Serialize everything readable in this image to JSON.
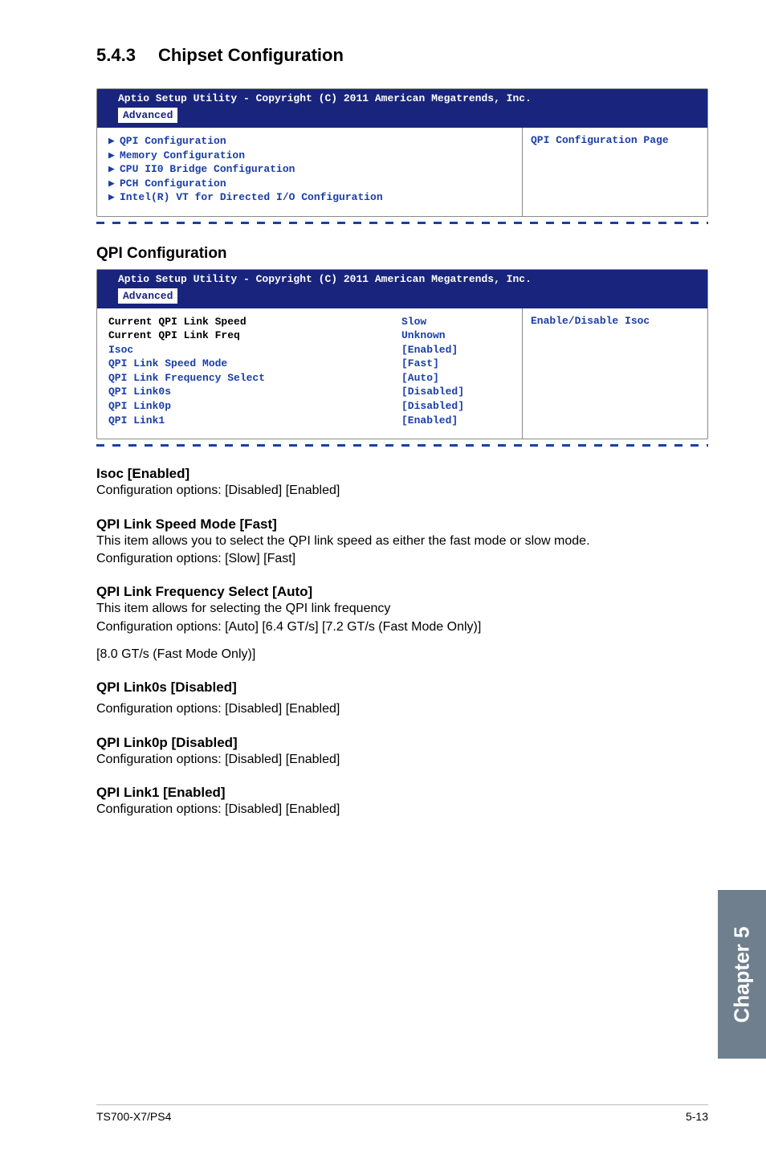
{
  "section": {
    "number": "5.4.3",
    "title": "Chipset Configuration"
  },
  "bios1": {
    "header": "Aptio Setup Utility - Copyright (C) 2011 American Megatrends, Inc.",
    "tab": "Advanced",
    "menu": [
      "QPI Configuration",
      "Memory Configuration",
      "CPU II0 Bridge Configuration",
      "PCH Configuration",
      "Intel(R) VT for Directed I/O Configuration"
    ],
    "help": "QPI Configuration Page"
  },
  "sub1": {
    "title": "QPI Configuration"
  },
  "bios2": {
    "header": "Aptio Setup Utility - Copyright (C) 2011 American Megatrends, Inc.",
    "tab": "Advanced",
    "rows": [
      {
        "label": "Current QPI Link Speed",
        "value": "Slow",
        "black": true
      },
      {
        "label": "Current QPI Link Freq",
        "value": "Unknown",
        "black": true
      },
      {
        "label": "Isoc",
        "value": "[Enabled]",
        "black": false
      },
      {
        "label": "QPI Link Speed Mode",
        "value": "[Fast]",
        "black": false
      },
      {
        "label": "QPI Link Frequency Select",
        "value": "[Auto]",
        "black": false
      },
      {
        "label": "QPI Link0s",
        "value": "[Disabled]",
        "black": false
      },
      {
        "label": "QPI Link0p",
        "value": "[Disabled]",
        "black": false
      },
      {
        "label": "QPI Link1",
        "value": "[Enabled]",
        "black": false
      }
    ],
    "help": "Enable/Disable Isoc"
  },
  "items": {
    "isoc": {
      "head": "Isoc [Enabled]",
      "body": "Configuration options: [Disabled] [Enabled]"
    },
    "speed": {
      "head": "QPI Link Speed Mode [Fast]",
      "body1": "This item allows you to select the QPI link speed as either the fast mode or slow mode.",
      "body2": "Configuration options: [Slow] [Fast]"
    },
    "freq": {
      "head": "QPI Link Frequency Select [Auto]",
      "body1": "This item allows for selecting the QPI link frequency",
      "body2": "Configuration options: [Auto] [6.4 GT/s] [7.2 GT/s (Fast Mode Only)]",
      "body3": "[8.0 GT/s (Fast Mode Only)]"
    },
    "link0s": {
      "head": "QPI Link0s [Disabled]",
      "body": "Configuration options: [Disabled] [Enabled]"
    },
    "link0p": {
      "head": "QPI Link0p [Disabled]",
      "body": "Configuration options: [Disabled] [Enabled]"
    },
    "link1": {
      "head": "QPI Link1 [Enabled]",
      "body": "Configuration options: [Disabled] [Enabled]"
    }
  },
  "chapter_tab": "Chapter 5",
  "footer": {
    "left": "TS700-X7/PS4",
    "right": "5-13"
  }
}
